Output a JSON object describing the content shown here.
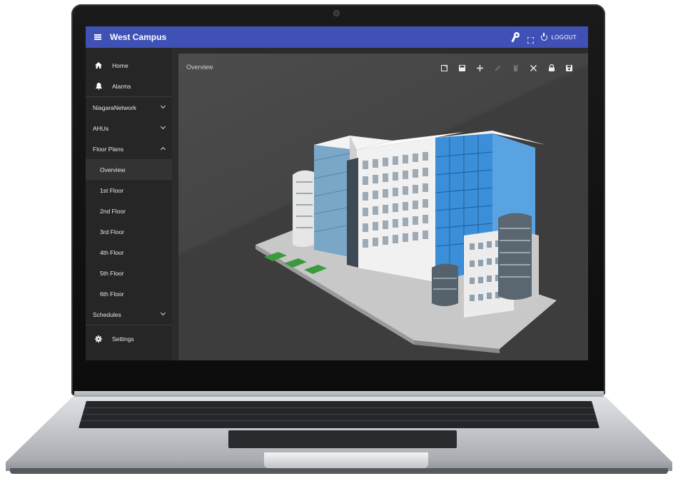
{
  "app": {
    "title": "West Campus",
    "logout_label": "LOGOUT"
  },
  "sidebar": {
    "items": [
      {
        "label": "Home",
        "icon": "home-icon",
        "type": "top"
      },
      {
        "label": "Alarms",
        "icon": "bell-icon",
        "type": "top"
      },
      {
        "label": "NiagaraNetwork",
        "type": "group",
        "expanded": false
      },
      {
        "label": "AHUs",
        "type": "group",
        "expanded": false
      },
      {
        "label": "Floor Plans",
        "type": "group",
        "expanded": true
      },
      {
        "label": "Overview",
        "type": "sub",
        "active": true
      },
      {
        "label": "1st Floor",
        "type": "sub"
      },
      {
        "label": "2nd Floor",
        "type": "sub"
      },
      {
        "label": "3rd Floor",
        "type": "sub"
      },
      {
        "label": "4th Floor",
        "type": "sub"
      },
      {
        "label": "5th Floor",
        "type": "sub"
      },
      {
        "label": "6th Floor",
        "type": "sub"
      },
      {
        "label": "Schedules",
        "type": "group",
        "expanded": false
      }
    ],
    "settings_label": "Settings"
  },
  "main": {
    "title": "Overview",
    "toolbar_icons": [
      "open-in-new-icon",
      "save-as-icon",
      "add-icon",
      "edit-icon",
      "delete-icon",
      "close-icon",
      "lock-icon",
      "save-icon"
    ]
  },
  "colors": {
    "appbar": "#3f51b5",
    "sidebar": "#262626",
    "main": "#3d3d3d",
    "glass": "#3b8fd9"
  }
}
